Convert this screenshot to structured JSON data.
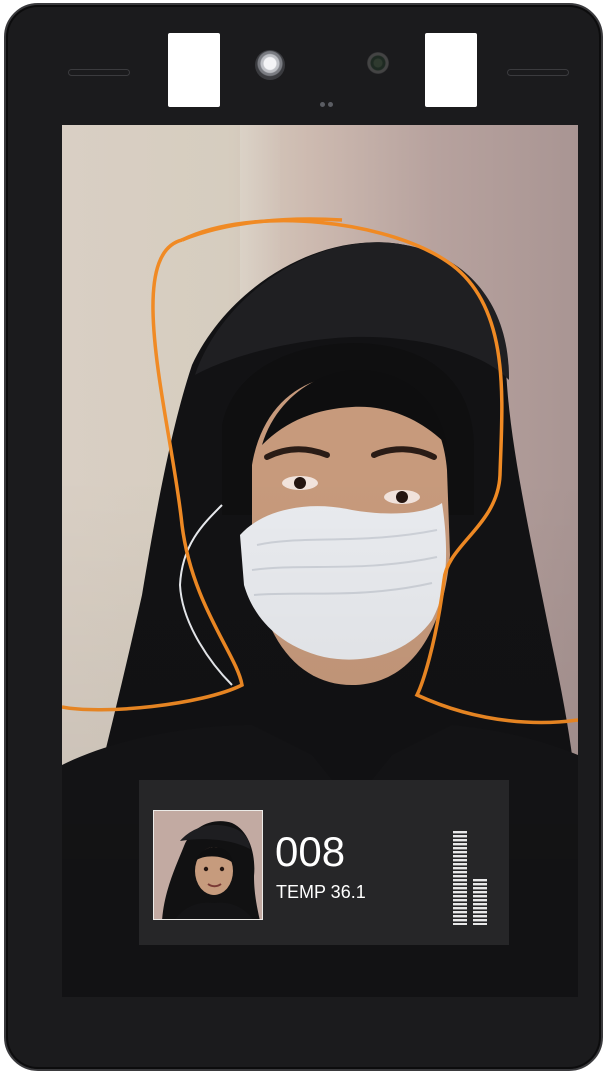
{
  "device": {
    "name": "face-recognition-terminal",
    "accent_color": "#f08a24"
  },
  "result_panel": {
    "user_id": "008",
    "temperature_label": "TEMP 36.1"
  },
  "signal_meter": {
    "left_bar_level": 1.0,
    "right_bar_level": 0.5
  }
}
